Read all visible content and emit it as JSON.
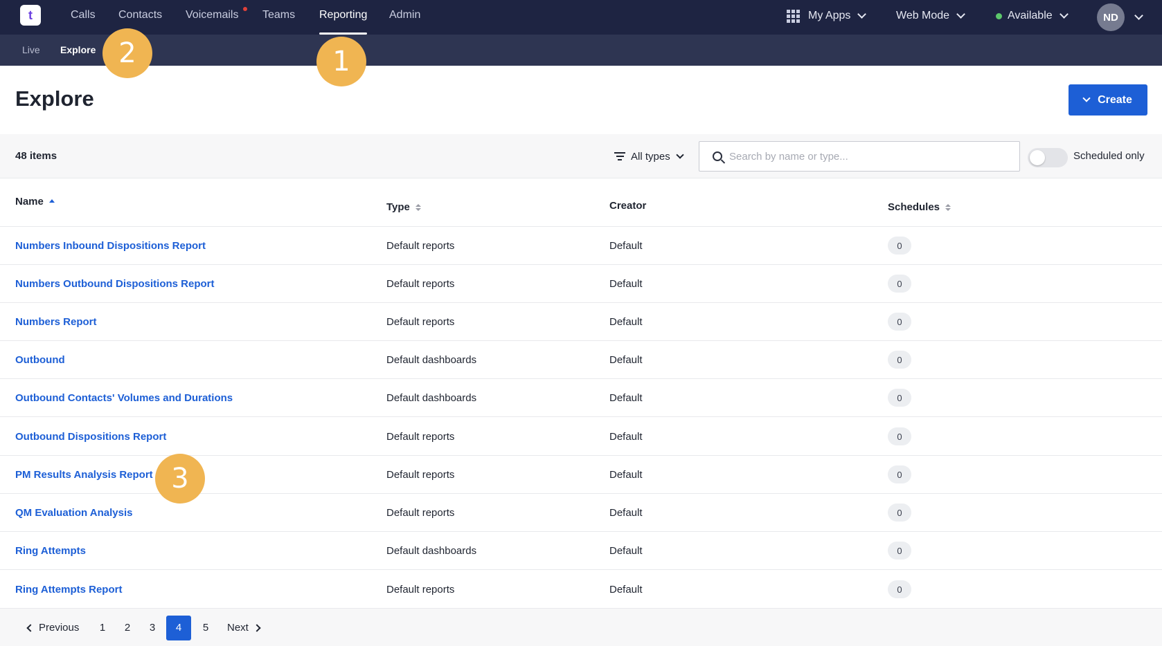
{
  "topnav": {
    "logo": "t",
    "items": [
      "Calls",
      "Contacts",
      "Voicemails",
      "Teams",
      "Reporting",
      "Admin"
    ],
    "active": "Reporting",
    "my_apps": "My Apps",
    "web_mode": "Web Mode",
    "status": "Available",
    "avatar": "ND"
  },
  "subnav": {
    "items": [
      "Live",
      "Explore"
    ],
    "active": "Explore"
  },
  "page": {
    "title": "Explore",
    "create_label": "Create"
  },
  "toolbar": {
    "count": "48 items",
    "filter_label": "All types",
    "search_placeholder": "Search by name or type...",
    "toggle_label": "Scheduled only"
  },
  "table": {
    "headers": {
      "name": "Name",
      "type": "Type",
      "creator": "Creator",
      "schedules": "Schedules"
    },
    "rows": [
      {
        "name": "Numbers Inbound Dispositions Report",
        "type": "Default reports",
        "creator": "Default",
        "schedules": "0"
      },
      {
        "name": "Numbers Outbound Dispositions Report",
        "type": "Default reports",
        "creator": "Default",
        "schedules": "0"
      },
      {
        "name": "Numbers Report",
        "type": "Default reports",
        "creator": "Default",
        "schedules": "0"
      },
      {
        "name": "Outbound",
        "type": "Default dashboards",
        "creator": "Default",
        "schedules": "0"
      },
      {
        "name": "Outbound Contacts' Volumes and Durations",
        "type": "Default dashboards",
        "creator": "Default",
        "schedules": "0"
      },
      {
        "name": "Outbound Dispositions Report",
        "type": "Default reports",
        "creator": "Default",
        "schedules": "0"
      },
      {
        "name": "PM Results Analysis Report",
        "type": "Default reports",
        "creator": "Default",
        "schedules": "0"
      },
      {
        "name": "QM Evaluation Analysis",
        "type": "Default reports",
        "creator": "Default",
        "schedules": "0"
      },
      {
        "name": "Ring Attempts",
        "type": "Default dashboards",
        "creator": "Default",
        "schedules": "0"
      },
      {
        "name": "Ring Attempts Report",
        "type": "Default reports",
        "creator": "Default",
        "schedules": "0"
      }
    ]
  },
  "pagination": {
    "previous": "Previous",
    "next": "Next",
    "pages": [
      "1",
      "2",
      "3",
      "4",
      "5"
    ],
    "current": "4"
  },
  "callouts": [
    "1",
    "2",
    "3"
  ],
  "colors": {
    "nav_bg": "#1e2442",
    "subnav_bg": "#2e3552",
    "accent": "#1d5fd6",
    "callout": "#f0b552"
  }
}
